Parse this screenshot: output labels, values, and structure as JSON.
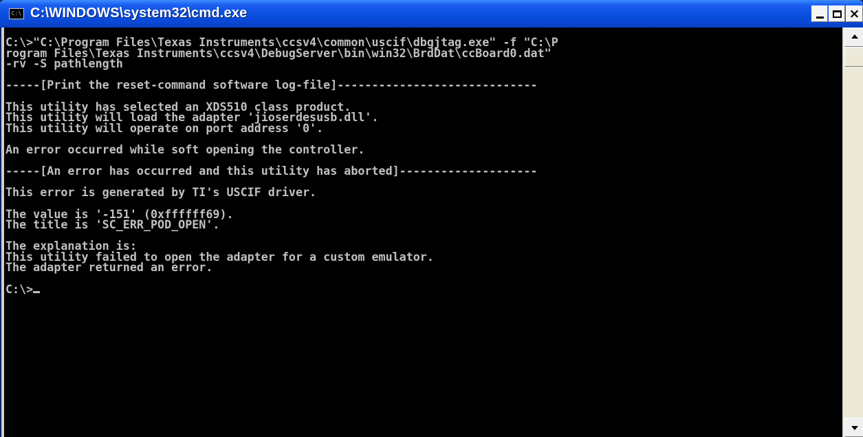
{
  "window": {
    "title": "C:\\WINDOWS\\system32\\cmd.exe",
    "icon": "cmd-icon",
    "icon_label": "C:\\",
    "controls": {
      "minimize": "minimize-icon",
      "maximize": "maximize-icon",
      "close": "close-icon",
      "close_glyph": "×"
    },
    "colors": {
      "titlebar": "#0a48d6",
      "console_bg": "#000000",
      "console_fg": "#c0c0c0"
    }
  },
  "console": {
    "lines": [
      "C:\\>\"C:\\Program Files\\Texas Instruments\\ccsv4\\common\\uscif\\dbgjtag.exe\" -f \"C:\\P",
      "rogram Files\\Texas Instruments\\ccsv4\\DebugServer\\bin\\win32\\BrdDat\\ccBoard0.dat\"",
      "-rv -S pathlength",
      "",
      "-----[Print the reset-command software log-file]-----------------------------",
      "",
      "This utility has selected an XDS510 class product.",
      "This utility will load the adapter 'jioserdesusb.dll'.",
      "This utility will operate on port address '0'.",
      "",
      "An error occurred while soft opening the controller.",
      "",
      "-----[An error has occurred and this utility has aborted]--------------------",
      "",
      "This error is generated by TI's USCIF driver.",
      "",
      "The value is '-151' (0xffffff69).",
      "The title is 'SC_ERR_POD_OPEN'.",
      "",
      "The explanation is:",
      "This utility failed to open the adapter for a custom emulator.",
      "The adapter returned an error.",
      ""
    ],
    "prompt": "C:\\>"
  },
  "scrollbar": {
    "up": "scroll-up-arrow-icon",
    "down": "scroll-down-arrow-icon"
  }
}
